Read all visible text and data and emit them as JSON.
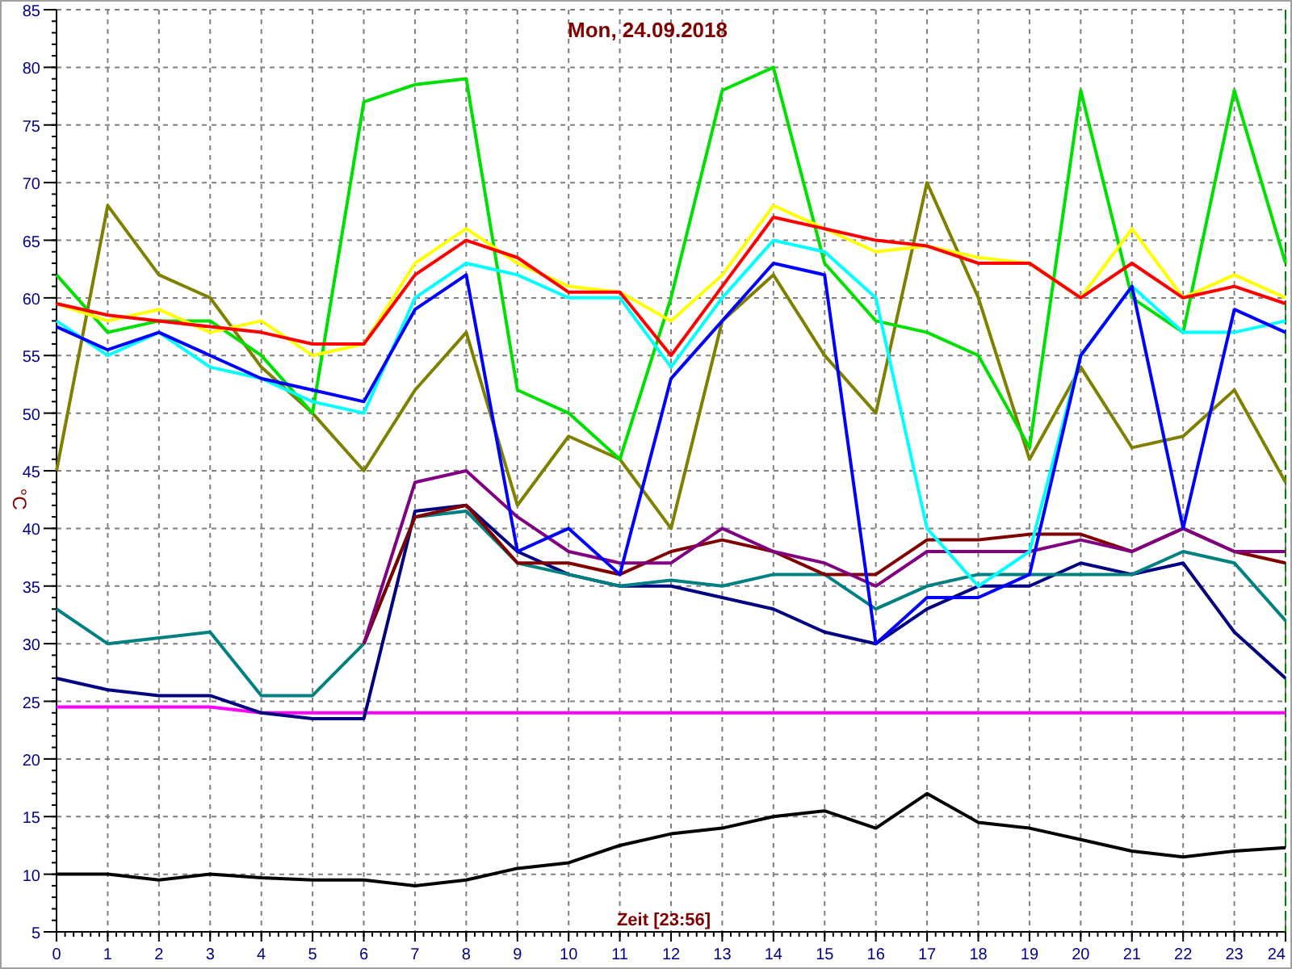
{
  "chart": {
    "chart_data": {
      "type": "line",
      "grid": true,
      "title": "Mon, 24.09.2018",
      "xlabel": "Zeit [23:56]",
      "ylabel": "°C",
      "x": [
        0,
        1,
        2,
        3,
        4,
        5,
        6,
        7,
        8,
        9,
        10,
        11,
        12,
        13,
        14,
        15,
        16,
        17,
        18,
        19,
        20,
        21,
        22,
        23,
        24
      ],
      "xlim": [
        0,
        24
      ],
      "ylim": [
        5,
        85
      ],
      "xticks": [
        0,
        1,
        2,
        3,
        4,
        5,
        6,
        7,
        8,
        9,
        10,
        11,
        12,
        13,
        14,
        15,
        16,
        17,
        18,
        19,
        20,
        21,
        22,
        23,
        24
      ],
      "yticks": [
        5,
        10,
        15,
        20,
        25,
        30,
        35,
        40,
        45,
        50,
        55,
        60,
        65,
        70,
        75,
        80,
        85
      ],
      "series": [
        {
          "color": "#000000",
          "values": [
            10,
            10,
            9.5,
            10,
            9.7,
            9.5,
            9.5,
            9,
            9.5,
            10.5,
            11,
            12.5,
            13.5,
            14,
            15,
            15.5,
            14,
            17,
            14.5,
            14,
            13,
            12,
            11.5,
            12,
            12.3
          ]
        },
        {
          "color": "#ff00ff",
          "values": [
            24.5,
            24.5,
            24.5,
            24.5,
            24,
            24,
            24,
            24,
            24,
            24,
            24,
            24,
            24,
            24,
            24,
            24,
            24,
            24,
            24,
            24,
            24,
            24,
            24,
            24,
            24
          ]
        },
        {
          "color": "#000080",
          "values": [
            27,
            26,
            25.5,
            25.5,
            24,
            23.5,
            23.5,
            41.5,
            42,
            38,
            36,
            35,
            35,
            34,
            33,
            31,
            30,
            33,
            35,
            35,
            37,
            36,
            37,
            31,
            27
          ]
        },
        {
          "color": "#008080",
          "values": [
            33,
            30,
            30.5,
            31,
            25.5,
            25.5,
            30,
            41,
            41.5,
            37,
            36,
            35,
            35.5,
            35,
            36,
            36,
            33,
            35,
            36,
            36,
            36,
            36,
            38,
            37,
            32
          ]
        },
        {
          "color": "#800000",
          "values": [
            null,
            null,
            null,
            null,
            null,
            null,
            30,
            41,
            42,
            37,
            37,
            36,
            38,
            39,
            38,
            36,
            36,
            39,
            39,
            39.5,
            39.5,
            38,
            40,
            38,
            37
          ]
        },
        {
          "color": "#800080",
          "values": [
            null,
            null,
            null,
            null,
            null,
            null,
            30,
            44,
            45,
            41,
            38,
            37,
            37,
            40,
            38,
            37,
            35,
            38,
            38,
            38,
            39,
            38,
            40,
            38,
            38
          ]
        },
        {
          "color": "#808000",
          "values": [
            45,
            68,
            62,
            60,
            54,
            50,
            45,
            52,
            57,
            42,
            48,
            46,
            40,
            58,
            62,
            55,
            50,
            70,
            60,
            46,
            54,
            47,
            48,
            52,
            44
          ]
        },
        {
          "color": "#00e000",
          "values": [
            62,
            57,
            58,
            58,
            55,
            50,
            77,
            78.5,
            79,
            52,
            50,
            46,
            60,
            78,
            80,
            63,
            58,
            57,
            55,
            47,
            78,
            60,
            57,
            78,
            63
          ]
        },
        {
          "color": "#00ffff",
          "values": [
            58,
            55,
            57,
            54,
            53,
            51,
            50,
            60,
            63,
            62,
            60,
            60,
            54,
            60,
            65,
            64,
            60,
            40,
            35,
            38,
            55,
            61,
            57,
            57,
            58
          ]
        },
        {
          "color": "#ffff00",
          "values": [
            59.5,
            58,
            59,
            57,
            58,
            55,
            56,
            63,
            66,
            63,
            61,
            60.5,
            58,
            62,
            68,
            66,
            64,
            64.5,
            63.5,
            63,
            60,
            66,
            60,
            62,
            60
          ]
        },
        {
          "color": "#ff0000",
          "values": [
            59.5,
            58.5,
            58,
            57.5,
            57,
            56,
            56,
            62,
            65,
            63.5,
            60.5,
            60.5,
            55,
            61,
            67,
            66,
            65,
            64.5,
            63,
            63,
            60,
            63,
            60,
            61,
            59.5
          ]
        },
        {
          "color": "#0000ff",
          "values": [
            57.5,
            55.5,
            57,
            55,
            53,
            52,
            51,
            59,
            62,
            38,
            40,
            36,
            53,
            58,
            63,
            62,
            30,
            34,
            34,
            36,
            55,
            61,
            40,
            59,
            57
          ]
        }
      ]
    }
  }
}
